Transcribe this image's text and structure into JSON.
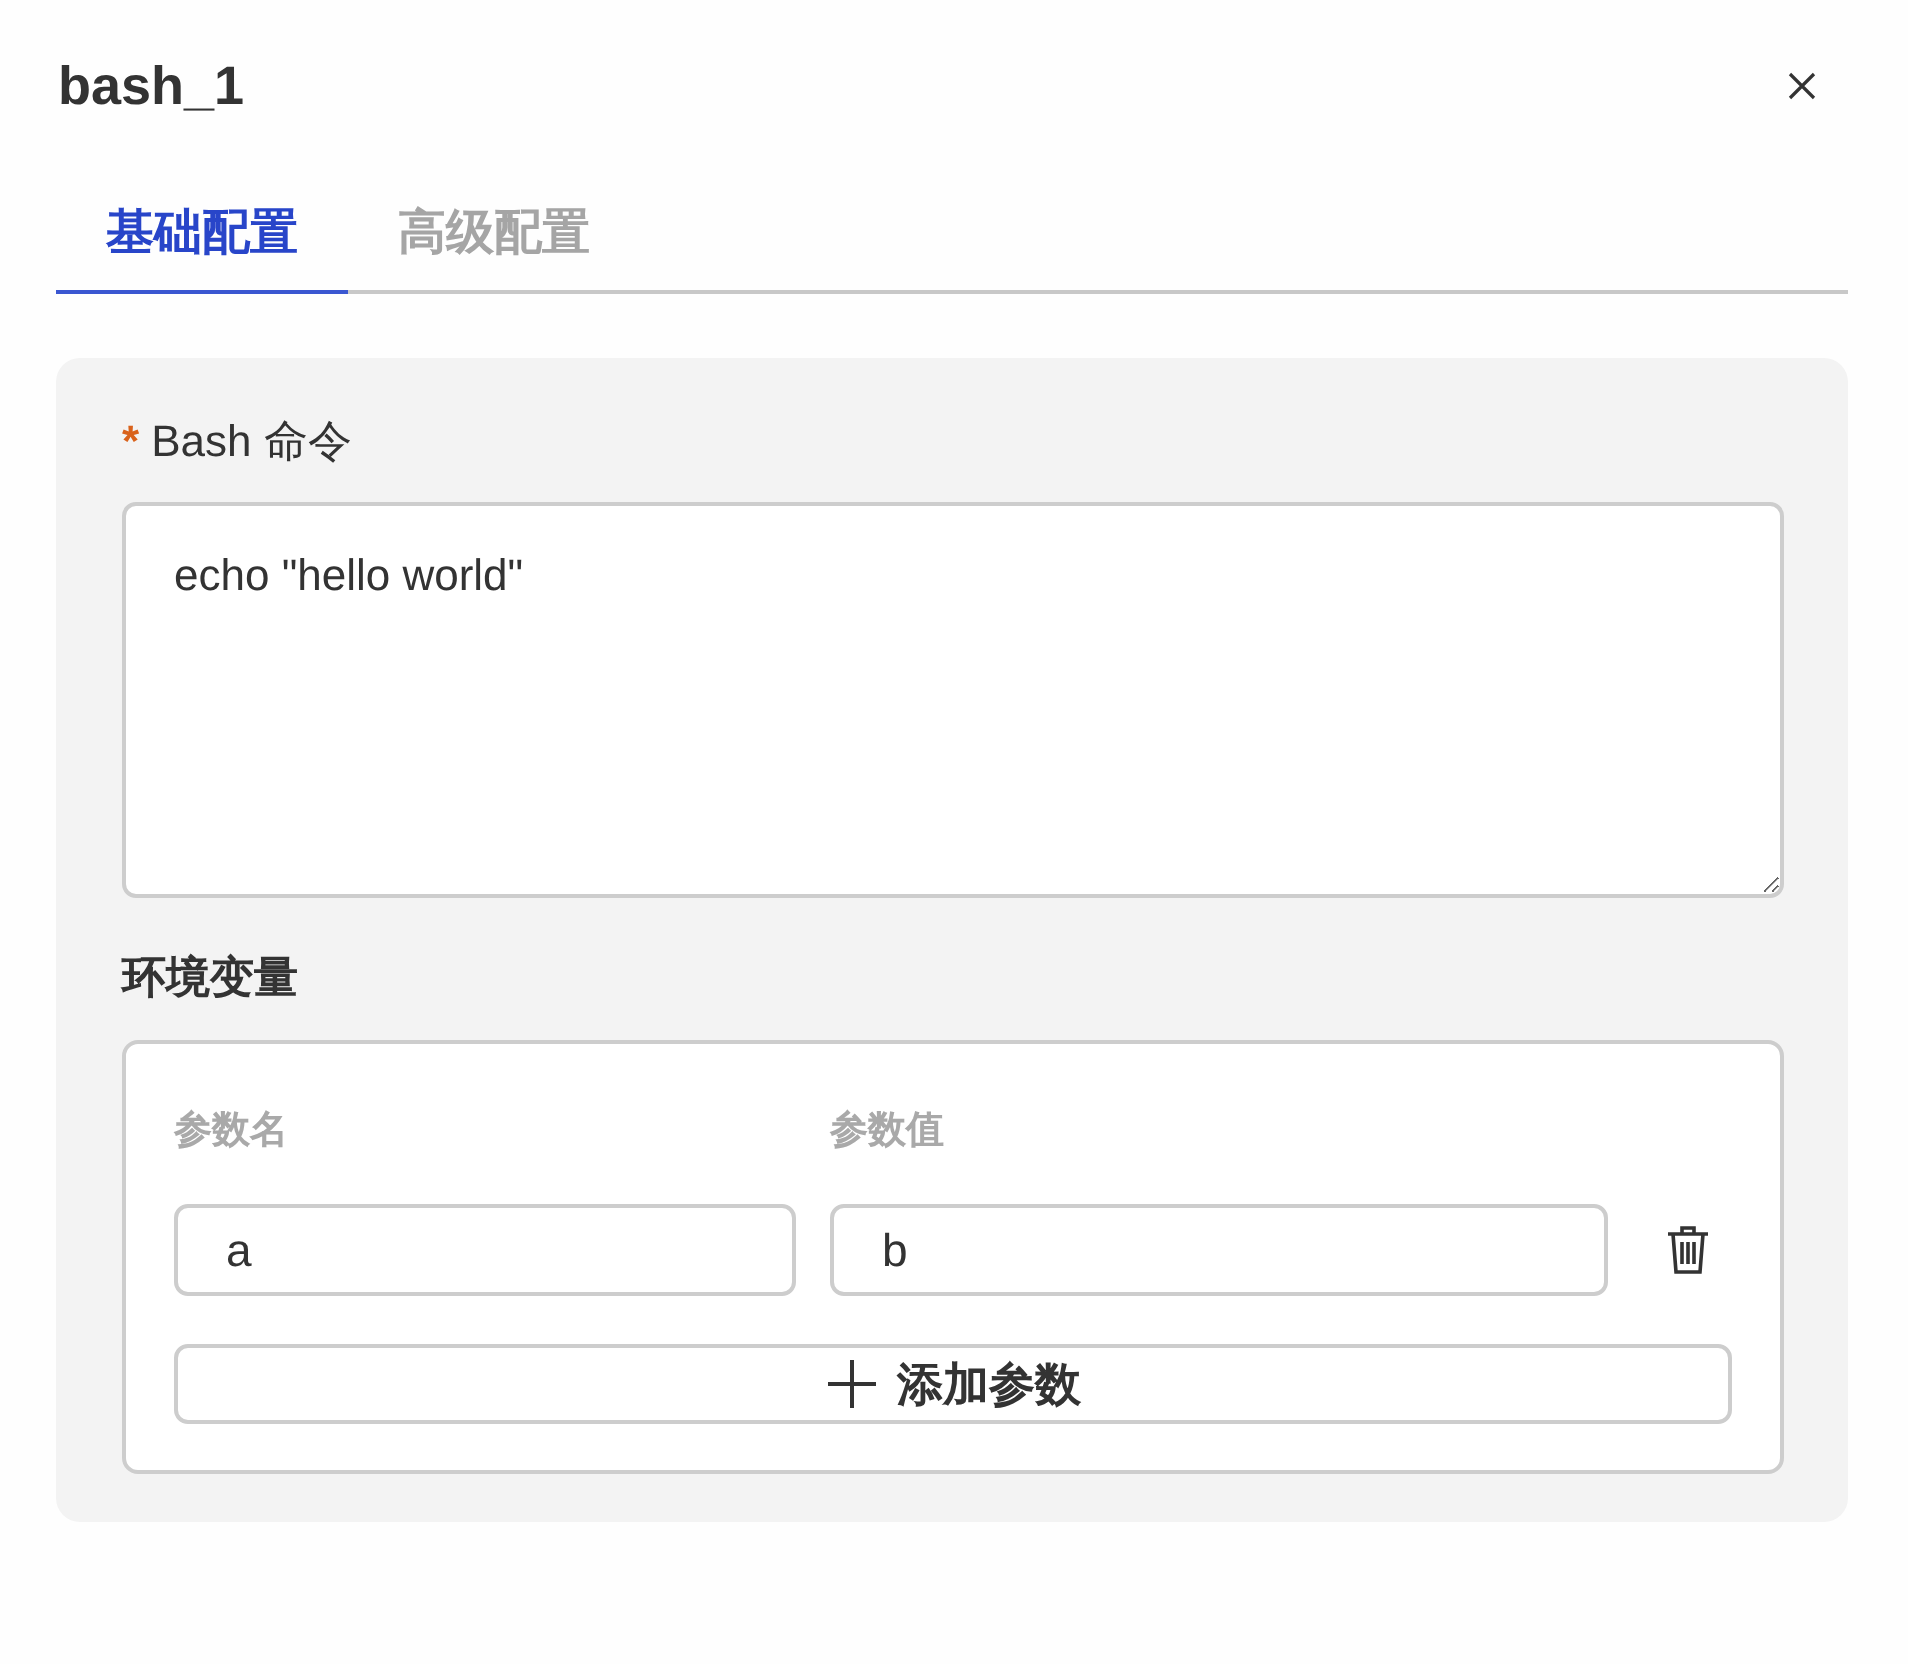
{
  "dialog": {
    "title": "bash_1"
  },
  "tabs": [
    {
      "label": "基础配置",
      "selected": true
    },
    {
      "label": "高级配置",
      "selected": false
    }
  ],
  "command": {
    "required_mark": "*",
    "label": "Bash 命令",
    "value": "echo \"hello world\""
  },
  "env": {
    "label": "环境变量",
    "columns": [
      "参数名",
      "参数值"
    ],
    "rows": [
      {
        "name": "a",
        "value": "b"
      }
    ],
    "add_button": "添加参数"
  }
}
